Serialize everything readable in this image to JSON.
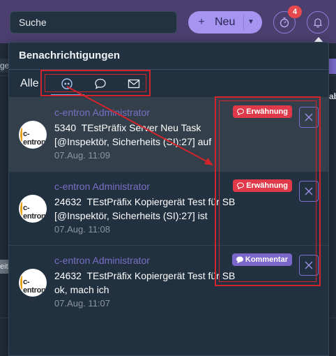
{
  "header": {
    "search_value": "Suche",
    "new_button_label": "Neu",
    "new_button_plus": "+",
    "timer_badge": "4"
  },
  "background": {
    "left_stub_text": "ge",
    "left_chip_text": "eit",
    "right_stub_text": "ab"
  },
  "panel": {
    "title": "Benachrichtigungen",
    "tabs": {
      "all_label": "Alle",
      "mention_icon": "mention-quote-icon",
      "comment_icon": "comment-bubble-icon",
      "mail_icon": "envelope-icon"
    },
    "notifications": [
      {
        "author": "c-entron Administrator",
        "line1": "5340  TEstPräfix Server Neu Task",
        "line2": "[@Inspektör, Sicherheits (SI):27] auf",
        "time": "07.Aug. 11:09",
        "tag": "Erwähnung",
        "tag_color": "#e03a4a",
        "avatar_text": "c-entron"
      },
      {
        "author": "c-entron Administrator",
        "line1": "24632  TEstPräfix Kopiergerät Test für SB",
        "line2": "[@Inspektör, Sicherheits (SI):27] ist",
        "time": "07.Aug. 11:08",
        "tag": "Erwähnung",
        "tag_color": "#e03a4a",
        "avatar_text": "c-entron"
      },
      {
        "author": "c-entron Administrator",
        "line1": "24632  TEstPräfix Kopiergerät Test für SB",
        "line2": "ok, mach ich",
        "time": "07.Aug. 11:07",
        "tag": "Kommentar",
        "tag_color": "#7a67c9",
        "avatar_text": "c-entron"
      }
    ]
  },
  "colors": {
    "accent": "#a594f0",
    "badge": "#e5484d",
    "annotation": "#d3232b"
  }
}
